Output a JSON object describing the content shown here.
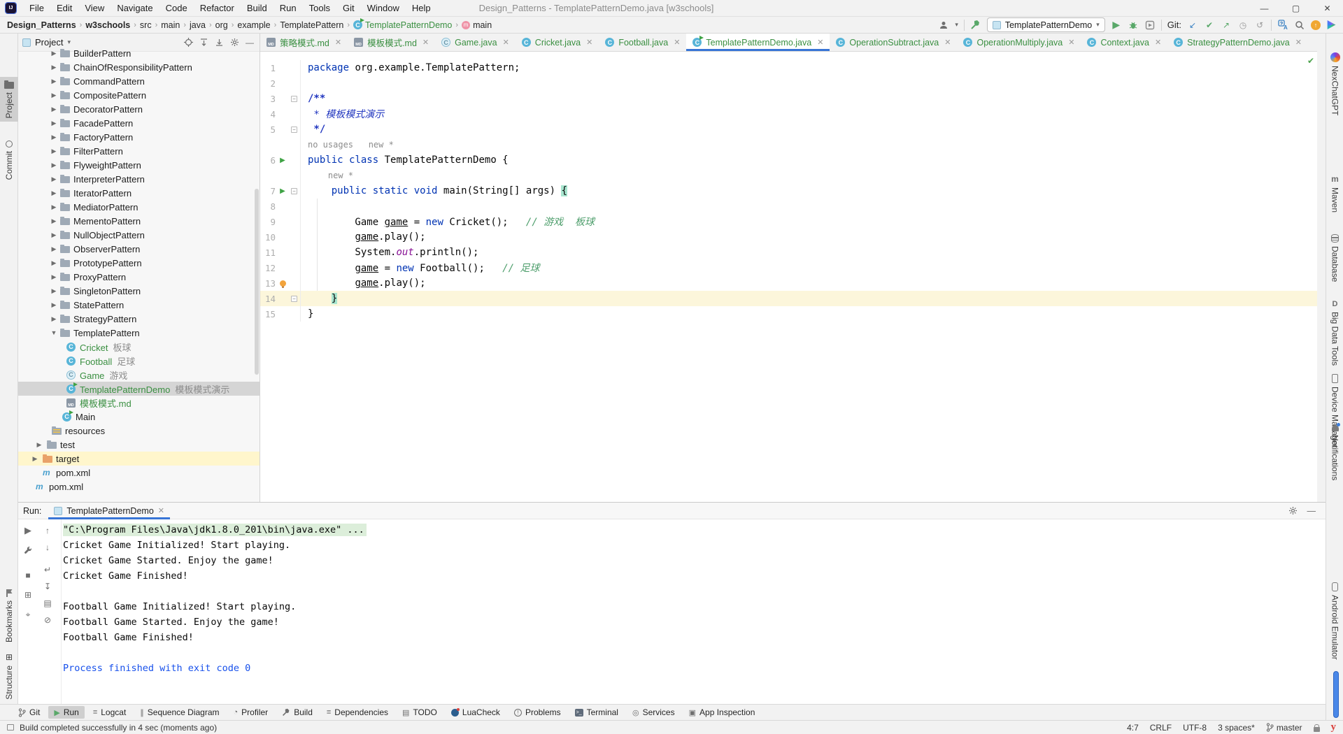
{
  "window": {
    "menus": [
      "File",
      "Edit",
      "View",
      "Navigate",
      "Code",
      "Refactor",
      "Build",
      "Run",
      "Tools",
      "Git",
      "Window",
      "Help"
    ],
    "title": "Design_Patterns - TemplatePatternDemo.java [w3schools]"
  },
  "toolbar": {
    "breadcrumbs": [
      {
        "label": "Design_Patterns",
        "bold": true
      },
      {
        "label": "w3schools",
        "bold": true
      },
      {
        "label": "src"
      },
      {
        "label": "main"
      },
      {
        "label": "java"
      },
      {
        "label": "org"
      },
      {
        "label": "example"
      },
      {
        "label": "TemplatePattern"
      },
      {
        "label": "TemplatePatternDemo",
        "icon": "class-run",
        "green": true
      },
      {
        "label": "main",
        "icon": "method"
      }
    ],
    "run_config": "TemplatePatternDemo",
    "git_label": "Git:"
  },
  "left_stripe": {
    "top": [
      {
        "label": "Project",
        "icon": "project",
        "active": true
      },
      {
        "label": "Commit",
        "icon": "commit"
      }
    ],
    "bottom": [
      {
        "label": "Bookmarks",
        "icon": "bookmarks"
      },
      {
        "label": "Structure",
        "icon": "structure"
      }
    ]
  },
  "right_stripe": [
    {
      "label": "NexChatGPT",
      "icon": "nexchatgpt"
    },
    {
      "label": "Maven",
      "icon": "maven"
    },
    {
      "label": "Database",
      "icon": "database"
    },
    {
      "label": "Big Data Tools",
      "icon": "bigdata"
    },
    {
      "label": "Device Manager",
      "icon": "device"
    },
    {
      "label": "Notifications",
      "icon": "notifications"
    },
    {
      "label": "Android Emulator",
      "icon": "android"
    }
  ],
  "project_panel": {
    "title": "Project",
    "tree": [
      {
        "label": "BuilderPattern",
        "icon": "folder",
        "arrow": "closed",
        "depth": "patterns"
      },
      {
        "label": "ChainOfResponsibilityPattern",
        "icon": "folder",
        "arrow": "closed",
        "depth": "patterns"
      },
      {
        "label": "CommandPattern",
        "icon": "folder",
        "arrow": "closed",
        "depth": "patterns"
      },
      {
        "label": "CompositePattern",
        "icon": "folder",
        "arrow": "closed",
        "depth": "patterns"
      },
      {
        "label": "DecoratorPattern",
        "icon": "folder",
        "arrow": "closed",
        "depth": "patterns"
      },
      {
        "label": "FacadePattern",
        "icon": "folder",
        "arrow": "closed",
        "depth": "patterns"
      },
      {
        "label": "FactoryPattern",
        "icon": "folder",
        "arrow": "closed",
        "depth": "patterns"
      },
      {
        "label": "FilterPattern",
        "icon": "folder",
        "arrow": "closed",
        "depth": "patterns"
      },
      {
        "label": "FlyweightPattern",
        "icon": "folder",
        "arrow": "closed",
        "depth": "patterns"
      },
      {
        "label": "InterpreterPattern",
        "icon": "folder",
        "arrow": "closed",
        "depth": "patterns"
      },
      {
        "label": "IteratorPattern",
        "icon": "folder",
        "arrow": "closed",
        "depth": "patterns"
      },
      {
        "label": "MediatorPattern",
        "icon": "folder",
        "arrow": "closed",
        "depth": "patterns"
      },
      {
        "label": "MementoPattern",
        "icon": "folder",
        "arrow": "closed",
        "depth": "patterns"
      },
      {
        "label": "NullObjectPattern",
        "icon": "folder",
        "arrow": "closed",
        "depth": "patterns"
      },
      {
        "label": "ObserverPattern",
        "icon": "folder",
        "arrow": "closed",
        "depth": "patterns"
      },
      {
        "label": "PrototypePattern",
        "icon": "folder",
        "arrow": "closed",
        "depth": "patterns"
      },
      {
        "label": "ProxyPattern",
        "icon": "folder",
        "arrow": "closed",
        "depth": "patterns"
      },
      {
        "label": "SingletonPattern",
        "icon": "folder",
        "arrow": "closed",
        "depth": "patterns"
      },
      {
        "label": "StatePattern",
        "icon": "folder",
        "arrow": "closed",
        "depth": "patterns"
      },
      {
        "label": "StrategyPattern",
        "icon": "folder",
        "arrow": "closed",
        "depth": "patterns"
      },
      {
        "label": "TemplatePattern",
        "icon": "folder",
        "arrow": "open",
        "depth": "patterns"
      },
      {
        "label": "Cricket",
        "meta": "板球",
        "icon": "class",
        "depth": "child",
        "green": true
      },
      {
        "label": "Football",
        "meta": "足球",
        "icon": "class",
        "depth": "child",
        "green": true
      },
      {
        "label": "Game",
        "meta": "游戏",
        "icon": "class-abstract",
        "depth": "child",
        "green": true
      },
      {
        "label": "TemplatePatternDemo",
        "meta": "模板模式演示",
        "icon": "class-run",
        "depth": "child",
        "green": true,
        "selected": true
      },
      {
        "label": "模板模式.md",
        "icon": "md",
        "depth": "child",
        "green": true
      },
      {
        "label": "Main",
        "icon": "class-run",
        "depth": "main"
      },
      {
        "label": "resources",
        "icon": "resources",
        "depth": "resources"
      },
      {
        "label": "test",
        "icon": "folder",
        "arrow": "closed",
        "depth": "test"
      },
      {
        "label": "target",
        "icon": "folder-orange",
        "arrow": "closed",
        "depth": "target",
        "highlight": true
      },
      {
        "label": "pom.xml",
        "icon": "maven",
        "depth": "pom1"
      },
      {
        "label": "pom.xml",
        "icon": "maven",
        "depth": "pom2"
      }
    ]
  },
  "editor": {
    "tabs": [
      {
        "label": "策略模式.md",
        "icon": "md"
      },
      {
        "label": "模板模式.md",
        "icon": "md"
      },
      {
        "label": "Game.java",
        "icon": "class-abstract"
      },
      {
        "label": "Cricket.java",
        "icon": "class"
      },
      {
        "label": "Football.java",
        "icon": "class"
      },
      {
        "label": "TemplatePatternDemo.java",
        "icon": "class-run",
        "selected": true
      },
      {
        "label": "OperationSubtract.java",
        "icon": "class"
      },
      {
        "label": "OperationMultiply.java",
        "icon": "class"
      },
      {
        "label": "Context.java",
        "icon": "class"
      },
      {
        "label": "StrategyPatternDemo.java",
        "icon": "class"
      }
    ],
    "rows": [
      {
        "n": "1",
        "tokens": [
          [
            "kw",
            "package"
          ],
          [
            "pln",
            " org.example.TemplatePattern;"
          ]
        ]
      },
      {
        "n": "2",
        "tokens": []
      },
      {
        "n": "3",
        "tokens": [
          [
            "doc",
            "/**"
          ]
        ],
        "marks": [
          "fold"
        ]
      },
      {
        "n": "4",
        "tokens": [
          [
            "doci",
            " * 模板模式演示"
          ]
        ]
      },
      {
        "n": "5",
        "tokens": [
          [
            "doc",
            " */"
          ]
        ],
        "marks": [
          "fold"
        ]
      },
      {
        "kind": "inlay",
        "tokens": [
          [
            "inlay",
            "no usages   new *"
          ]
        ]
      },
      {
        "n": "6",
        "tokens": [
          [
            "kw",
            "public"
          ],
          [
            "pln",
            " "
          ],
          [
            "kw",
            "class"
          ],
          [
            "pln",
            " TemplatePatternDemo {"
          ]
        ],
        "marks": [
          "run"
        ]
      },
      {
        "kind": "inlay",
        "tokens": [
          [
            "inlay",
            "    new *"
          ]
        ]
      },
      {
        "n": "7",
        "tokens": [
          [
            "pln",
            "    "
          ],
          [
            "kw",
            "public"
          ],
          [
            "pln",
            " "
          ],
          [
            "kw",
            "static"
          ],
          [
            "pln",
            " "
          ],
          [
            "kw",
            "void"
          ],
          [
            "pln",
            " main(String[] args) "
          ],
          [
            "brc",
            "{"
          ]
        ],
        "marks": [
          "run",
          "fold"
        ]
      },
      {
        "n": "8",
        "tokens": []
      },
      {
        "n": "9",
        "tokens": [
          [
            "pln",
            "        Game "
          ],
          [
            "var",
            "game"
          ],
          [
            "pln",
            " = "
          ],
          [
            "kw",
            "new"
          ],
          [
            "pln",
            " Cricket();"
          ],
          [
            "cmt",
            "   // 游戏  板球"
          ]
        ]
      },
      {
        "n": "10",
        "tokens": [
          [
            "pln",
            "        "
          ],
          [
            "var",
            "game"
          ],
          [
            "pln",
            ".play();"
          ]
        ]
      },
      {
        "n": "11",
        "tokens": [
          [
            "pln",
            "        System."
          ],
          [
            "fld",
            "out"
          ],
          [
            "pln",
            ".println();"
          ]
        ]
      },
      {
        "n": "12",
        "tokens": [
          [
            "pln",
            "        "
          ],
          [
            "var",
            "game"
          ],
          [
            "pln",
            " = "
          ],
          [
            "kw",
            "new"
          ],
          [
            "pln",
            " Football();"
          ],
          [
            "cmt",
            "   // 足球"
          ]
        ]
      },
      {
        "n": "13",
        "tokens": [
          [
            "pln",
            "        "
          ],
          [
            "var",
            "game"
          ],
          [
            "pln",
            ".play();"
          ]
        ],
        "marks": [
          "bulb"
        ]
      },
      {
        "n": "14",
        "tokens": [
          [
            "pln",
            "    "
          ],
          [
            "brc",
            "}"
          ]
        ],
        "marks": [
          "fold"
        ],
        "current": true
      },
      {
        "n": "15",
        "tokens": [
          [
            "pln",
            "}"
          ]
        ]
      }
    ]
  },
  "run_panel": {
    "label": "Run:",
    "tab": "TemplatePatternDemo",
    "console": [
      {
        "text": "\"C:\\Program Files\\Java\\jdk1.8.0_201\\bin\\java.exe\" ...",
        "highlight": true
      },
      {
        "text": "Cricket Game Initialized! Start playing."
      },
      {
        "text": "Cricket Game Started. Enjoy the game!"
      },
      {
        "text": "Cricket Game Finished!"
      },
      {
        "text": ""
      },
      {
        "text": "Football Game Initialized! Start playing."
      },
      {
        "text": "Football Game Started. Enjoy the game!"
      },
      {
        "text": "Football Game Finished!"
      },
      {
        "text": ""
      },
      {
        "text": "Process finished with exit code 0",
        "blue": true
      }
    ]
  },
  "bottom_bar": [
    {
      "label": "Git",
      "icon": "git-branch"
    },
    {
      "label": "Run",
      "icon": "run",
      "active": true
    },
    {
      "label": "Logcat",
      "icon": "logcat"
    },
    {
      "label": "Sequence Diagram",
      "icon": "sequence"
    },
    {
      "label": "Profiler",
      "icon": "profiler"
    },
    {
      "label": "Build",
      "icon": "build"
    },
    {
      "label": "Dependencies",
      "icon": "dependencies"
    },
    {
      "label": "TODO",
      "icon": "todo"
    },
    {
      "label": "LuaCheck",
      "icon": "luacheck"
    },
    {
      "label": "Problems",
      "icon": "problems"
    },
    {
      "label": "Terminal",
      "icon": "terminal"
    },
    {
      "label": "Services",
      "icon": "services"
    },
    {
      "label": "App Inspection",
      "icon": "app-inspection"
    }
  ],
  "status_bar": {
    "message": "Build completed successfully in 4 sec (moments ago)",
    "caret": "4:7",
    "line_ending": "CRLF",
    "encoding": "UTF-8",
    "indent": "3 spaces*",
    "branch": "master",
    "plugin": "y"
  }
}
